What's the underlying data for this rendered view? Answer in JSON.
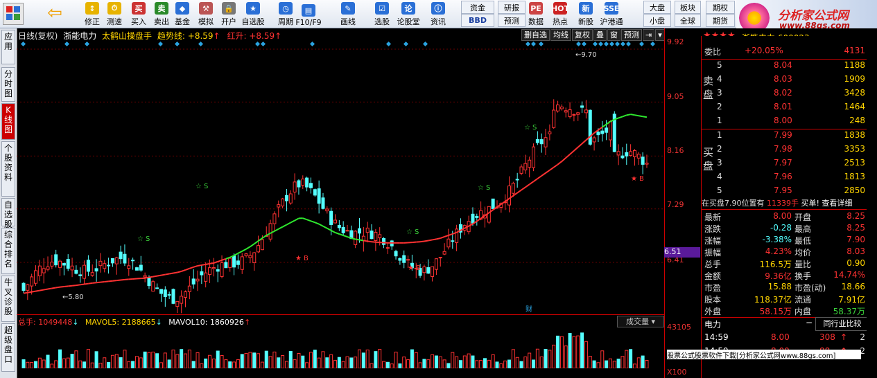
{
  "toolbar": {
    "buttons": [
      {
        "label": "修正",
        "icon": "up-down-arrows-icon"
      },
      {
        "label": "测速",
        "icon": "stopwatch-icon"
      },
      {
        "label": "买入",
        "icon": "buy-icon"
      },
      {
        "label": "卖出",
        "icon": "sell-icon"
      },
      {
        "label": "基金",
        "icon": "fund-icon"
      },
      {
        "label": "模拟",
        "icon": "hammer-icon"
      },
      {
        "label": "开户",
        "icon": "lock-icon"
      },
      {
        "label": "自选股",
        "icon": "star-list-icon"
      },
      {
        "label": "周期",
        "icon": "clock-icon"
      },
      {
        "label": "F10/F9",
        "icon": "document-icon"
      },
      {
        "label": "画线",
        "icon": "pen-icon"
      },
      {
        "label": "选股",
        "icon": "checklist-icon"
      },
      {
        "label": "论股堂",
        "icon": "discussion-icon"
      },
      {
        "label": "资讯",
        "icon": "info-icon"
      },
      {
        "label": "数据",
        "icon": "pe-icon"
      },
      {
        "label": "热点",
        "icon": "hot-icon"
      },
      {
        "label": "新股",
        "icon": "new-stock-icon"
      },
      {
        "label": "沪港通",
        "icon": "hk-connect-icon"
      }
    ],
    "small_buttons": [
      "资金",
      "BBD",
      "研报",
      "预测",
      "大盘",
      "小盘",
      "板块",
      "全球",
      "期权",
      "期货"
    ],
    "icon_only": [
      "window-layout-icon",
      "back-arrow-icon"
    ]
  },
  "logo": {
    "title": "分析家公式网",
    "url": "www.88gs.com"
  },
  "left_tabs": [
    "应用",
    "分时图",
    "K线图",
    "个股资料",
    "自选股",
    "综合排名",
    "牛叉诊股",
    "超级盘口"
  ],
  "active_left_tab": "K线图",
  "chart": {
    "info": {
      "period": "日线(复权)",
      "stock": "浙能电力",
      "indicator": "太鹤山操盘手",
      "trend_label": "趋势线:",
      "trend_value": "+8.59",
      "red_label": "红升:",
      "red_value": "+8.59"
    },
    "tabs": [
      "删自选",
      "均线",
      "复权",
      "叠",
      "窗",
      "预测",
      "⇥",
      "▾"
    ],
    "annotations": {
      "high": "9.70",
      "low": "5.80",
      "s_mark": "S",
      "b_mark": "B",
      "fin_mark": "财"
    },
    "price_labels": [
      "9.92",
      "9.05",
      "8.16",
      "7.29",
      "6.41"
    ],
    "current_price": "6.51",
    "volume_labels": [
      "43105",
      "X100"
    ],
    "volume_info": {
      "total_label": "总手:",
      "total": "1049448",
      "mavol5_label": "MAVOL5:",
      "mavol5": "2188665",
      "mavol10_label": "MAVOL10:",
      "mavol10": "1860926"
    },
    "volume_tab": "成交量"
  },
  "chart_data": {
    "type": "candlestick",
    "ylim": [
      5.8,
      9.92
    ],
    "price_ticks": [
      9.92,
      9.05,
      8.16,
      7.29,
      6.41
    ],
    "close_trend": [
      5.95,
      6.0,
      6.05,
      6.08,
      6.12,
      6.15,
      6.18,
      6.2,
      6.25,
      6.3,
      6.4,
      6.45,
      6.55,
      6.7,
      6.9,
      7.05,
      7.2,
      7.1,
      6.95,
      6.85,
      6.8,
      6.78,
      6.78,
      6.8,
      6.85,
      6.95,
      7.1,
      7.3,
      7.5,
      7.7,
      7.9,
      8.1,
      8.35,
      8.6,
      8.8,
      8.9,
      8.85
    ]
  },
  "quote": {
    "title": "浙能电力",
    "code": "600023",
    "webi_label": "委比",
    "webi": "+20.05%",
    "webi_num": "4131",
    "sell_label": "卖盘",
    "buy_label": "买盘",
    "sell": [
      {
        "lvl": "5",
        "price": "8.04",
        "vol": "1188"
      },
      {
        "lvl": "4",
        "price": "8.03",
        "vol": "1909"
      },
      {
        "lvl": "3",
        "price": "8.02",
        "vol": "3428"
      },
      {
        "lvl": "2",
        "price": "8.01",
        "vol": "1464"
      },
      {
        "lvl": "1",
        "price": "8.00",
        "vol": "248"
      }
    ],
    "buy": [
      {
        "lvl": "1",
        "price": "7.99",
        "vol": "1838"
      },
      {
        "lvl": "2",
        "price": "7.98",
        "vol": "3353"
      },
      {
        "lvl": "3",
        "price": "7.97",
        "vol": "2513"
      },
      {
        "lvl": "4",
        "price": "7.96",
        "vol": "1813"
      },
      {
        "lvl": "5",
        "price": "7.95",
        "vol": "2850"
      }
    ],
    "alert": {
      "text": "在买盘7.90位置有",
      "qty": "11339手",
      "tag": "买单!",
      "link": "查看详细"
    },
    "stats": [
      {
        "k1": "最新",
        "v1": "8.00",
        "k2": "开盘",
        "v2": "8.25"
      },
      {
        "k1": "涨跌",
        "v1": "-0.28",
        "k2": "最高",
        "v2": "8.25"
      },
      {
        "k1": "涨幅",
        "v1": "-3.38%",
        "k2": "最低",
        "v2": "7.90"
      },
      {
        "k1": "振幅",
        "v1": "4.23%",
        "k2": "均价",
        "v2": "8.03"
      },
      {
        "k1": "总手",
        "v1": "116.5万",
        "k2": "量比",
        "v2": "0.90"
      },
      {
        "k1": "金额",
        "v1": "9.36亿",
        "k2": "换手",
        "v2": "14.74%"
      },
      {
        "k1": "市盈",
        "v1": "15.88",
        "k2": "市盈(动)",
        "v2": "18.66"
      },
      {
        "k1": "股本",
        "v1": "118.37亿",
        "k2": "流通",
        "v2": "7.91亿"
      },
      {
        "k1": "外盘",
        "v1": "58.15万",
        "k2": "内盘",
        "v2": "58.37万"
      }
    ],
    "bottom_tab": "电力",
    "bottom_tab2": "同行业比较",
    "trades": [
      {
        "time": "14:59",
        "price": "8.00",
        "vol": "308",
        "n": "2"
      },
      {
        "time": "14:59",
        "price": "8.00",
        "vol": "88",
        "n": "2"
      }
    ]
  },
  "watermark": "股票公式股票软件下载[分析家公式网www.88gs.com]",
  "colors": {
    "up": "#ff3232",
    "down": "#54ffff",
    "trend_green": "#2ee82e",
    "price": "#ff3232"
  }
}
